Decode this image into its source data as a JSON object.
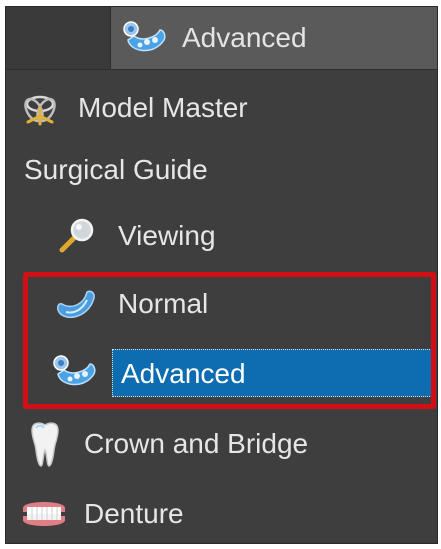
{
  "topbar": {
    "label": "Advanced",
    "icon": "advanced-guide-icon"
  },
  "tree": {
    "model_master": {
      "label": "Model Master",
      "icon": "model-master-icon"
    },
    "surgical_guide": {
      "label": "Surgical Guide"
    },
    "viewing": {
      "label": "Viewing",
      "icon": "magnifier-icon"
    },
    "normal": {
      "label": "Normal",
      "icon": "normal-guide-icon"
    },
    "advanced": {
      "label": "Advanced",
      "icon": "advanced-guide-icon",
      "selected": true
    },
    "crown_and_bridge": {
      "label": "Crown and Bridge",
      "icon": "tooth-icon"
    },
    "denture": {
      "label": "Denture",
      "icon": "denture-icon"
    }
  },
  "colors": {
    "panel_bg": "#3e3e3e",
    "topbar_bg": "#5a5a5a",
    "selection_bg": "#0e6cb0",
    "highlight_frame": "#d10f14",
    "text": "#e6e6e6"
  }
}
